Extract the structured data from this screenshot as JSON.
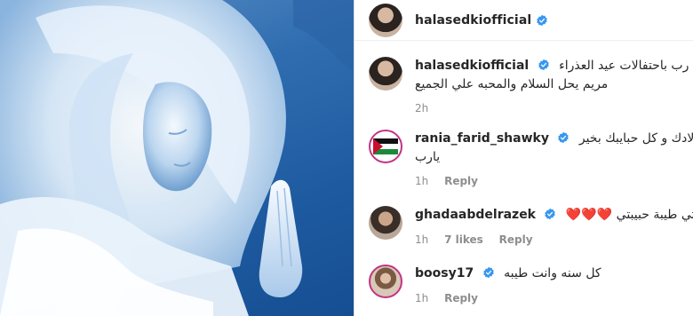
{
  "post": {
    "author": "halasedkiofficial",
    "verified": true
  },
  "comments": [
    {
      "username": "halasedkiofficial",
      "verified": true,
      "text_line1": "كل سنة ومصر بالف خير يا رب باحتفالات عيد العذراء",
      "text_line2": "مريم يحل السلام والمحبه علي الجميع",
      "time": "2h"
    },
    {
      "username": "rania_farid_shawky",
      "verified": true,
      "text_line1": "كل سنة وانتي طيبة حبيبتي و اولادك و كل حبايبك بخير",
      "text_line2": "يارب",
      "time": "1h",
      "reply": "Reply"
    },
    {
      "username": "ghadaabdelrazek",
      "verified": true,
      "text_line1": "كل سنة وانتي طيبة حبيبتي ❤️❤️❤️",
      "time": "1h",
      "likes": "7 likes",
      "reply": "Reply"
    },
    {
      "username": "boosy17",
      "verified": true,
      "text_line1": "كل سنه وانت طيبه",
      "time": "1h",
      "reply": "Reply"
    }
  ],
  "colors": {
    "verified_badge": "#3897f0",
    "meta_text": "#8e8e8e",
    "text": "#262626"
  },
  "icons": [
    "verified-icon"
  ]
}
